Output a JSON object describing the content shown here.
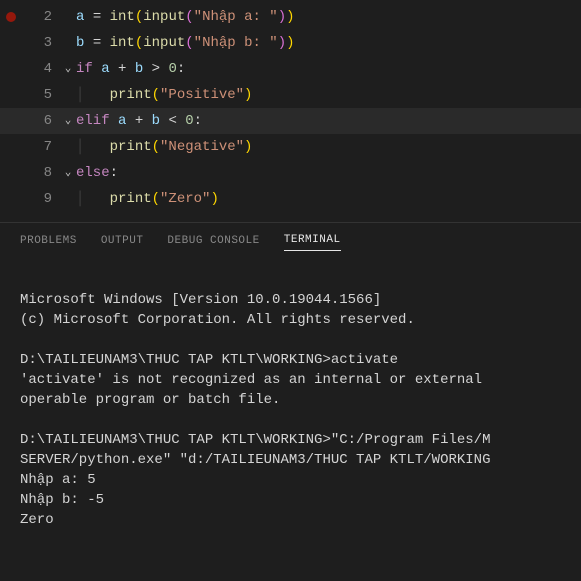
{
  "editor": {
    "lines": [
      {
        "num": "2",
        "fold": "",
        "guide": "",
        "breakpoint": true,
        "tokens": [
          {
            "t": "a",
            "c": "var"
          },
          {
            "t": " ",
            "c": "op"
          },
          {
            "t": "=",
            "c": "op"
          },
          {
            "t": " ",
            "c": "op"
          },
          {
            "t": "int",
            "c": "fn"
          },
          {
            "t": "(",
            "c": "paren"
          },
          {
            "t": "input",
            "c": "fn"
          },
          {
            "t": "(",
            "c": "paren2"
          },
          {
            "t": "\"Nhập a: \"",
            "c": "str"
          },
          {
            "t": ")",
            "c": "paren2"
          },
          {
            "t": ")",
            "c": "paren"
          }
        ]
      },
      {
        "num": "3",
        "fold": "",
        "guide": "",
        "tokens": [
          {
            "t": "b",
            "c": "var"
          },
          {
            "t": " ",
            "c": "op"
          },
          {
            "t": "=",
            "c": "op"
          },
          {
            "t": " ",
            "c": "op"
          },
          {
            "t": "int",
            "c": "fn"
          },
          {
            "t": "(",
            "c": "paren"
          },
          {
            "t": "input",
            "c": "fn"
          },
          {
            "t": "(",
            "c": "paren2"
          },
          {
            "t": "\"Nhập b: \"",
            "c": "str"
          },
          {
            "t": ")",
            "c": "paren2"
          },
          {
            "t": ")",
            "c": "paren"
          }
        ]
      },
      {
        "num": "4",
        "fold": "⌄",
        "guide": "",
        "tokens": [
          {
            "t": "if",
            "c": "kw"
          },
          {
            "t": " ",
            "c": "op"
          },
          {
            "t": "a",
            "c": "var"
          },
          {
            "t": " ",
            "c": "op"
          },
          {
            "t": "+",
            "c": "op"
          },
          {
            "t": " ",
            "c": "op"
          },
          {
            "t": "b",
            "c": "var"
          },
          {
            "t": " ",
            "c": "op"
          },
          {
            "t": ">",
            "c": "op"
          },
          {
            "t": " ",
            "c": "op"
          },
          {
            "t": "0",
            "c": "num"
          },
          {
            "t": ":",
            "c": "op"
          }
        ]
      },
      {
        "num": "5",
        "fold": "",
        "guide": "│   ",
        "tokens": [
          {
            "t": "print",
            "c": "fn"
          },
          {
            "t": "(",
            "c": "paren"
          },
          {
            "t": "\"Positive\"",
            "c": "str"
          },
          {
            "t": ")",
            "c": "paren"
          }
        ]
      },
      {
        "num": "6",
        "fold": "⌄",
        "guide": "",
        "current": true,
        "tokens": [
          {
            "t": "elif",
            "c": "kw"
          },
          {
            "t": " ",
            "c": "op"
          },
          {
            "t": "a",
            "c": "var"
          },
          {
            "t": " ",
            "c": "op"
          },
          {
            "t": "+",
            "c": "op"
          },
          {
            "t": " ",
            "c": "op"
          },
          {
            "t": "b",
            "c": "var"
          },
          {
            "t": " ",
            "c": "op"
          },
          {
            "t": "<",
            "c": "op"
          },
          {
            "t": " ",
            "c": "op"
          },
          {
            "t": "0",
            "c": "num"
          },
          {
            "t": ":",
            "c": "op"
          }
        ]
      },
      {
        "num": "7",
        "fold": "",
        "guide": "│   ",
        "tokens": [
          {
            "t": "print",
            "c": "fn"
          },
          {
            "t": "(",
            "c": "paren"
          },
          {
            "t": "\"Negative\"",
            "c": "str"
          },
          {
            "t": ")",
            "c": "paren"
          }
        ]
      },
      {
        "num": "8",
        "fold": "⌄",
        "guide": "",
        "tokens": [
          {
            "t": "else",
            "c": "kw"
          },
          {
            "t": ":",
            "c": "op"
          }
        ]
      },
      {
        "num": "9",
        "fold": "",
        "guide": "│   ",
        "tokens": [
          {
            "t": "print",
            "c": "fn"
          },
          {
            "t": "(",
            "c": "paren"
          },
          {
            "t": "\"Zero\"",
            "c": "str"
          },
          {
            "t": ")",
            "c": "paren"
          }
        ]
      }
    ]
  },
  "panel": {
    "tabs": [
      {
        "label": "PROBLEMS",
        "active": false
      },
      {
        "label": "OUTPUT",
        "active": false
      },
      {
        "label": "DEBUG CONSOLE",
        "active": false
      },
      {
        "label": "TERMINAL",
        "active": true
      }
    ],
    "terminal_lines": [
      "",
      "Microsoft Windows [Version 10.0.19044.1566]",
      "(c) Microsoft Corporation. All rights reserved.",
      "",
      "D:\\TAILIEUNAM3\\THUC TAP KTLT\\WORKING>activate",
      "'activate' is not recognized as an internal or external",
      "operable program or batch file.",
      "",
      "D:\\TAILIEUNAM3\\THUC TAP KTLT\\WORKING>\"C:/Program Files/M",
      "SERVER/python.exe\" \"d:/TAILIEUNAM3/THUC TAP KTLT/WORKING",
      "Nhập a: 5",
      "Nhập b: -5",
      "Zero"
    ]
  }
}
